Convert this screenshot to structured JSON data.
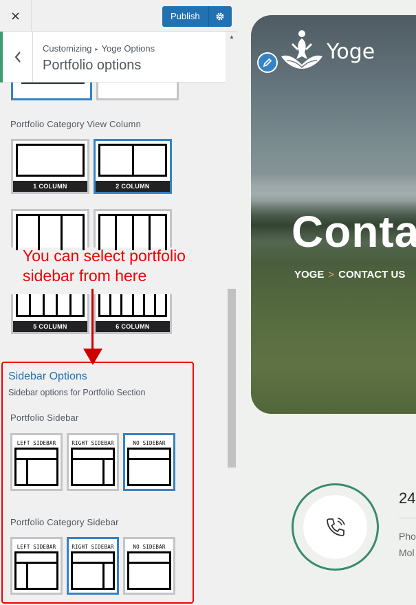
{
  "topbar": {
    "close_icon": "×",
    "publish_label": "Publish",
    "settings_icon": "gear-icon"
  },
  "section": {
    "crumb_root": "Customizing",
    "crumb_sep": "▸",
    "crumb_parent": "Yoge Options",
    "title": "Portfolio options"
  },
  "category_view_column": {
    "label": "Portfolio Category View Column",
    "options": [
      {
        "caption": "1 COLUMN",
        "columns": 1,
        "selected": false
      },
      {
        "caption": "2 COLUMN",
        "columns": 2,
        "selected": true
      },
      {
        "caption": "",
        "columns": 3,
        "selected": false
      },
      {
        "caption": "",
        "columns": 4,
        "selected": false
      },
      {
        "caption": "5 COLUMN",
        "columns": 5,
        "selected": false
      },
      {
        "caption": "6 COLUMN",
        "columns": 6,
        "selected": false
      }
    ]
  },
  "sidebar_options": {
    "heading": "Sidebar Options",
    "description": "Sidebar options for Portfolio Section"
  },
  "portfolio_sidebar": {
    "label": "Portfolio Sidebar",
    "options": [
      {
        "caption": "LEFT SIDEBAR",
        "selected": false
      },
      {
        "caption": "RIGHT SIDEBAR",
        "selected": false
      },
      {
        "caption": "NO SIDEBAR",
        "selected": true
      }
    ]
  },
  "portfolio_category_sidebar": {
    "label": "Portfolio Category Sidebar",
    "options": [
      {
        "caption": "LEFT SIDEBAR",
        "selected": false
      },
      {
        "caption": "RIGHT SIDEBAR",
        "selected": true
      },
      {
        "caption": "NO SIDEBAR",
        "selected": false
      }
    ]
  },
  "annotation": {
    "line1": "You can select portfolio",
    "line2": "sidebar from here",
    "color": "#e00000"
  },
  "preview": {
    "logo_text": "Yoge",
    "hero_title": "Conta",
    "crumb_home": "YOGE",
    "crumb_sep": ">",
    "crumb_current": "CONTACT US",
    "contact_number": "24",
    "contact_line1": "Pho",
    "contact_line2": "Mol"
  },
  "colors": {
    "accent": "#2271b1",
    "selected_border": "#3582c4",
    "green_accent": "#3c8a6c"
  }
}
